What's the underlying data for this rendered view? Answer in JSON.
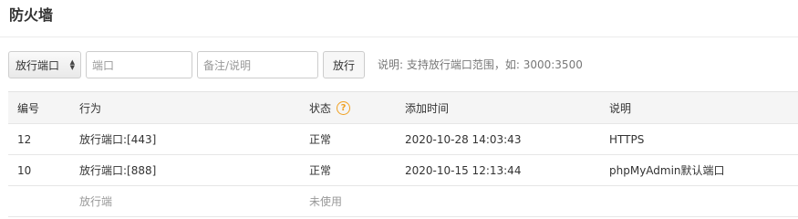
{
  "page": {
    "title": "防火墙"
  },
  "toolbar": {
    "type_select": "放行端口",
    "port_placeholder": "端口",
    "note_placeholder": "备注/说明",
    "submit_label": "放行",
    "hint": "说明: 支持放行端口范围，如: 3000:3500"
  },
  "table": {
    "headers": {
      "id": "编号",
      "action": "行为",
      "status": "状态",
      "added": "添加时间",
      "note": "说明"
    },
    "rows": [
      {
        "id": "12",
        "action": "放行端口:[443]",
        "status": "正常",
        "added": "2020-10-28 14:03:43",
        "note": "HTTPS"
      },
      {
        "id": "10",
        "action": "放行端口:[888]",
        "status": "正常",
        "added": "2020-10-15 12:13:44",
        "note": "phpMyAdmin默认端口"
      }
    ],
    "partial_row": {
      "action": "放行端",
      "status": "未使用"
    }
  },
  "icons": {
    "help": "help-circle-icon",
    "select_arrows": "updown-arrows-icon"
  },
  "colors": {
    "help_accent": "#f0a020"
  }
}
